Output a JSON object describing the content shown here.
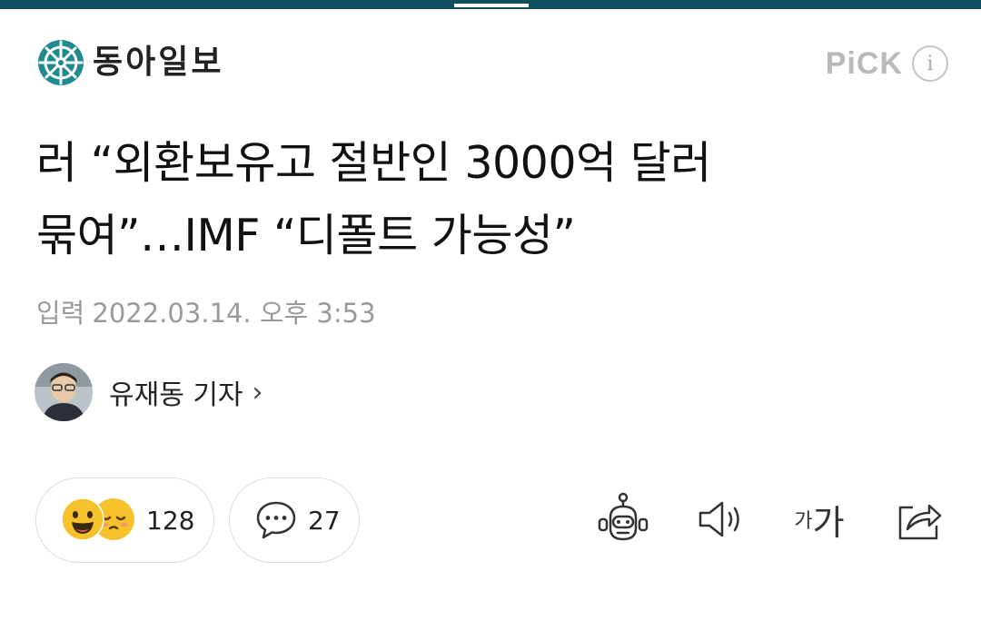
{
  "press": {
    "name": "동아일보"
  },
  "pick": {
    "label": "PiCK",
    "info_icon": "info-icon"
  },
  "article": {
    "headline_line1": "러 “외환보유고 절반인 3000억 달러",
    "headline_line2": "묶여”…IMF “디폴트 가능성”",
    "date_label": "입력",
    "date_value": "2022.03.14. 오후 3:53"
  },
  "author": {
    "name": "유재동 기자",
    "chevron": "›",
    "avatar_icon": "avatar"
  },
  "reactions": {
    "count": "128",
    "icons": [
      "smile-emoji-icon",
      "sad-emoji-icon"
    ]
  },
  "comments": {
    "count": "27",
    "icon": "speech-bubble-icon"
  },
  "toolbar": {
    "robot_icon": "robot-summary-icon",
    "sound_icon": "speaker-icon",
    "font_small": "가",
    "font_big": "가",
    "share_icon": "share-icon"
  },
  "colors": {
    "top_bar": "#0f4e5c",
    "logo_teal": "#1f8a92",
    "pick_gray": "#b9b9b9",
    "emoji_yellow": "#f6c22b"
  }
}
